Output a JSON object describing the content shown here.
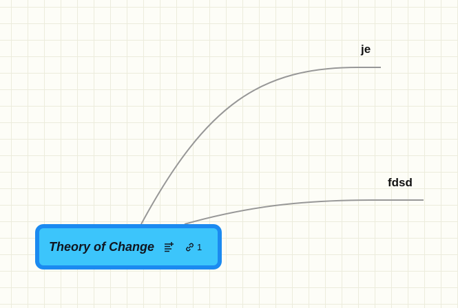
{
  "mindmap": {
    "root": {
      "title": "Theory of Change",
      "notes_icon": "notes-add-icon",
      "link_icon": "link-icon",
      "link_count": "1"
    },
    "branches": [
      {
        "label": "je"
      },
      {
        "label": "fdsd"
      }
    ]
  },
  "colors": {
    "root_fill": "#3cc5fb",
    "root_border": "#1b8af0",
    "connector": "#979797",
    "grid_line": "#ececdc",
    "background": "#fdfdf7"
  }
}
